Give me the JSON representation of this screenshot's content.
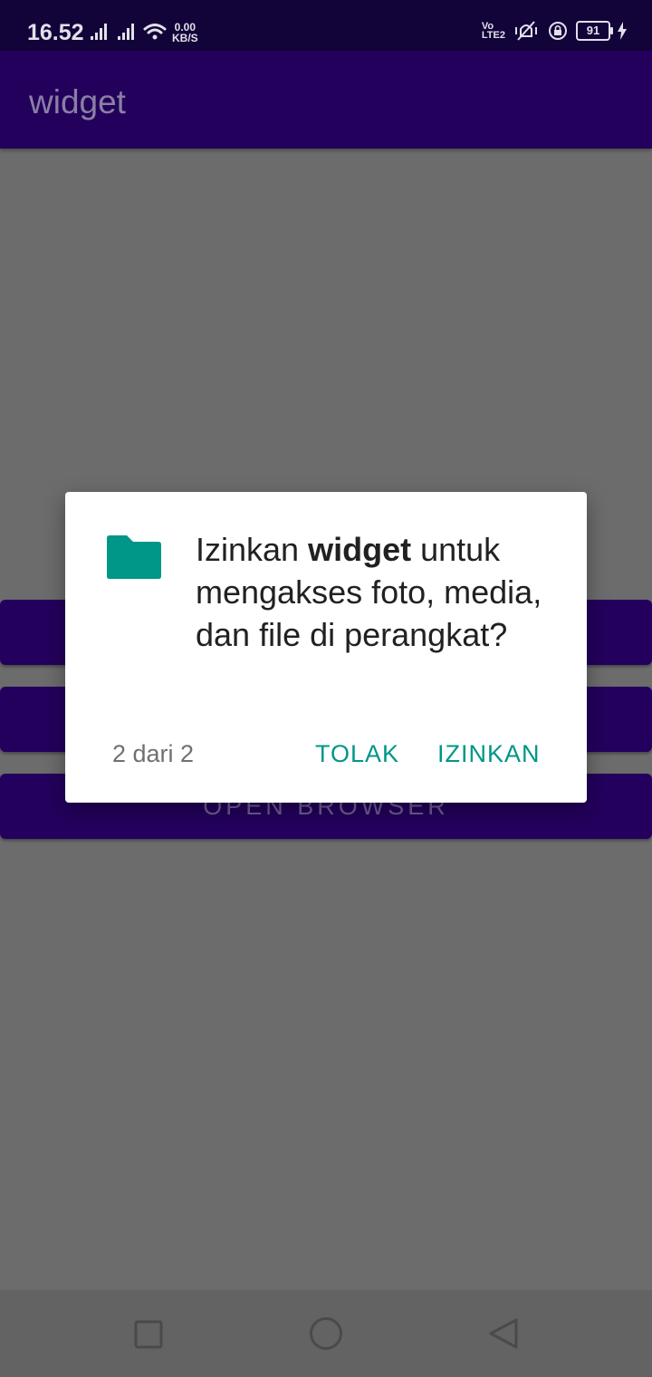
{
  "status_bar": {
    "time": "16.52",
    "net_speed_value": "0.00",
    "net_speed_unit": "KB/S",
    "volte_top": "Vo",
    "volte_bottom": "LTE",
    "volte_sim": "2",
    "battery_level": "91"
  },
  "app_bar": {
    "title": "widget"
  },
  "buttons": [
    {
      "label": ""
    },
    {
      "label": ""
    },
    {
      "label": "OPEN BROWSER"
    }
  ],
  "dialog": {
    "message_prefix": "Izinkan ",
    "message_app": "widget",
    "message_suffix": " untuk mengakses foto, media, dan file di perangkat?",
    "counter": "2 dari 2",
    "deny_label": "TOLAK",
    "allow_label": "IZINKAN",
    "icon": "folder-icon",
    "accent_color": "#009688"
  },
  "nav_bar": {
    "recents_icon": "square-recents-icon",
    "home_icon": "circle-home-icon",
    "back_icon": "triangle-back-icon"
  }
}
